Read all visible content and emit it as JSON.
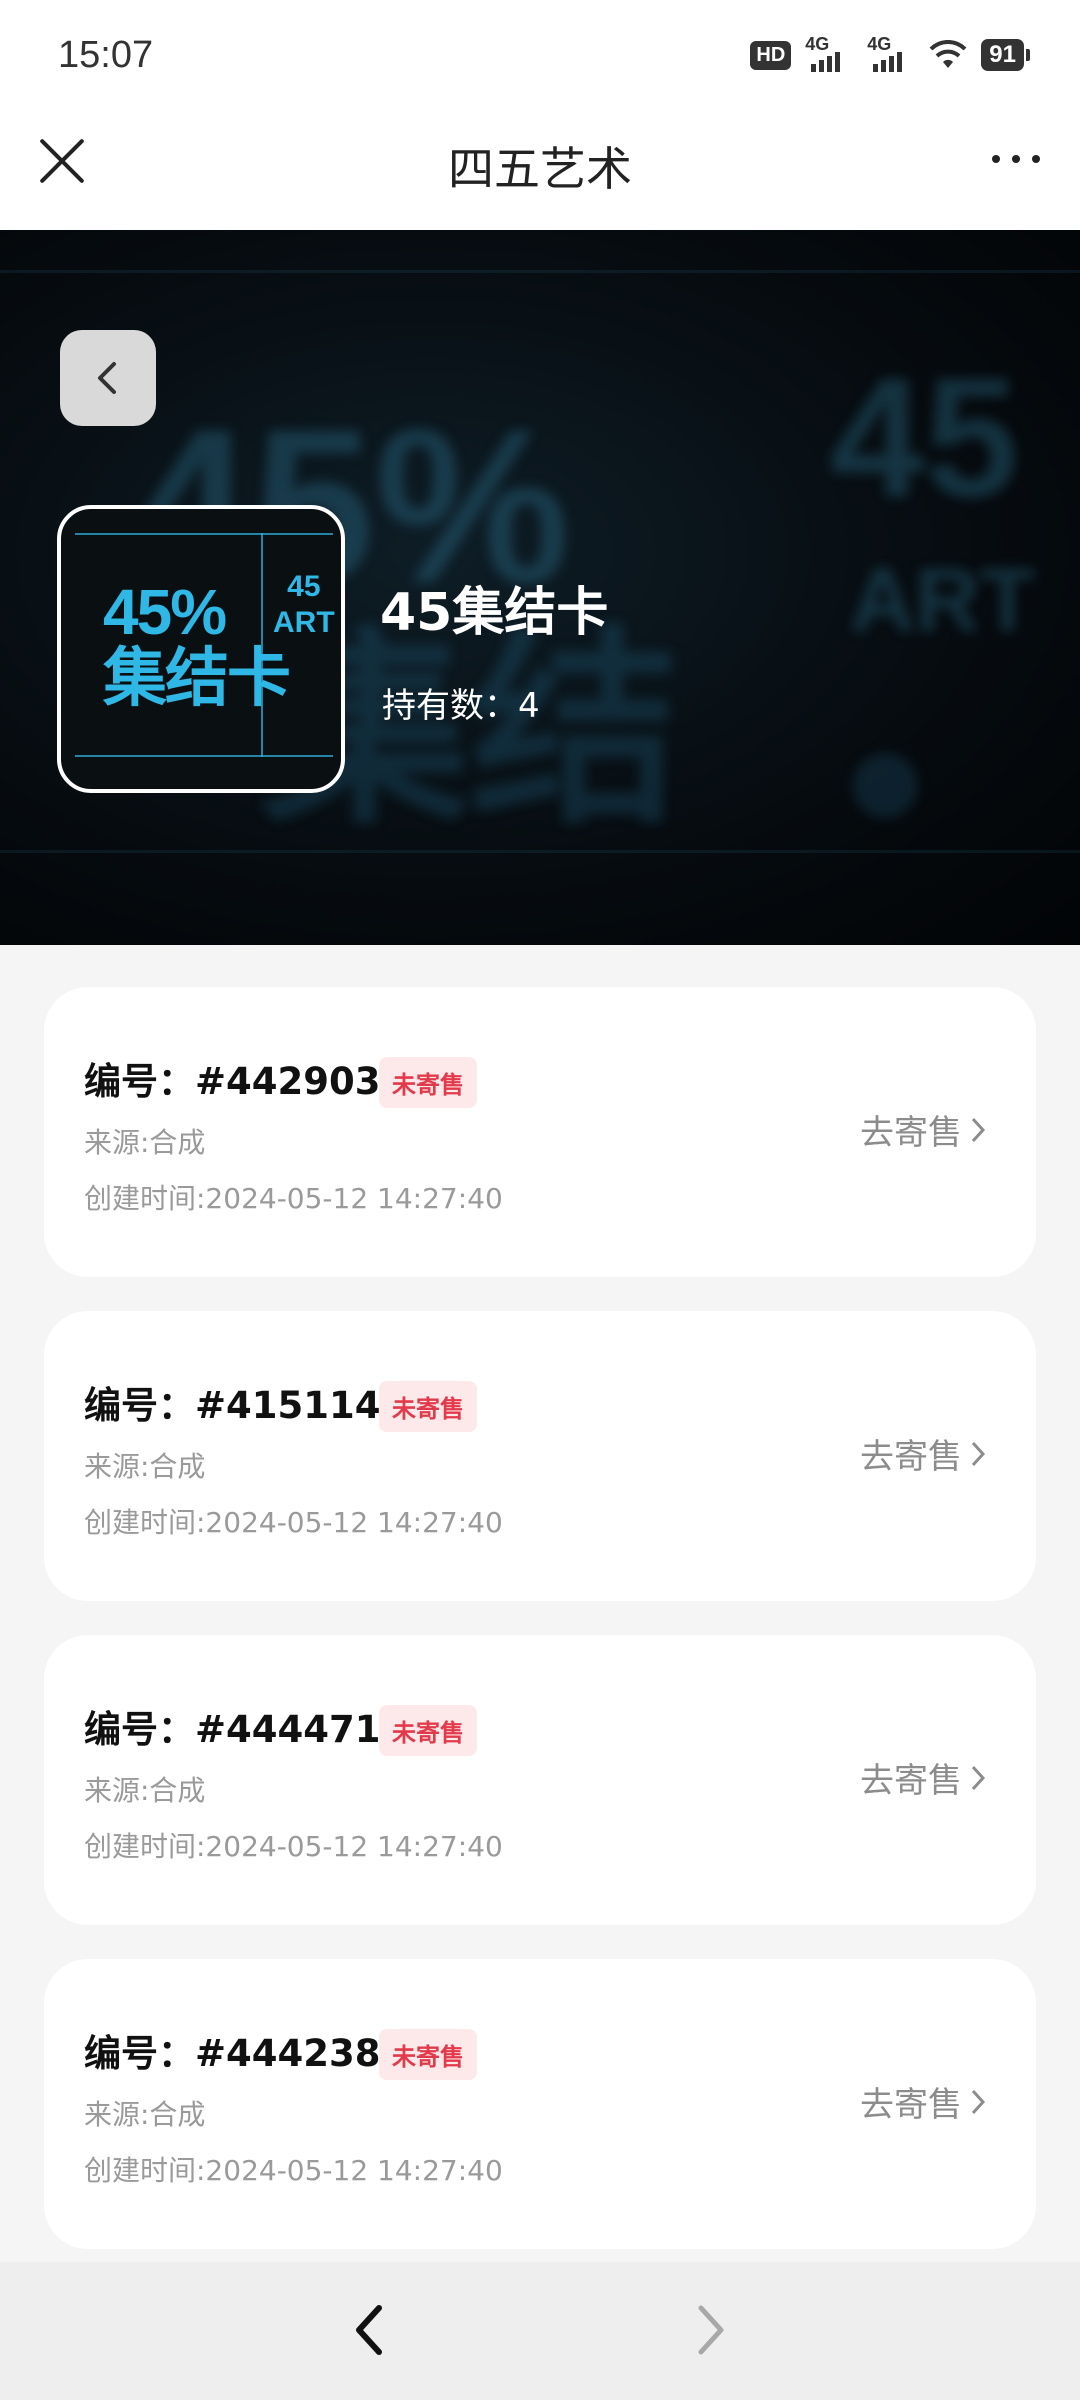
{
  "status_bar": {
    "time": "15:07",
    "hd": "HD",
    "network1": "4G",
    "network2": "4G",
    "battery": "91"
  },
  "header": {
    "title": "四五艺术"
  },
  "collection": {
    "name": "45集结卡",
    "holding_label": "持有数：",
    "holding_count": "4",
    "cover_text_main": "45%\n集结卡",
    "cover_text_side": "45\nART"
  },
  "items": [
    {
      "serial": "编号：#4429033",
      "status": "未寄售",
      "source": "来源:合成",
      "created": "创建时间:2024-05-12 14:27:40",
      "action": "去寄售"
    },
    {
      "serial": "编号：#4151143",
      "status": "未寄售",
      "source": "来源:合成",
      "created": "创建时间:2024-05-12 14:27:40",
      "action": "去寄售"
    },
    {
      "serial": "编号：#4444718",
      "status": "未寄售",
      "source": "来源:合成",
      "created": "创建时间:2024-05-12 14:27:40",
      "action": "去寄售"
    },
    {
      "serial": "编号：#4442388",
      "status": "未寄售",
      "source": "来源:合成",
      "created": "创建时间:2024-05-12 14:27:40",
      "action": "去寄售"
    }
  ],
  "colors": {
    "accent_badge_text": "#e23a4a",
    "accent_badge_bg": "#fde8ea",
    "cover_cyan": "#2fb7e6"
  }
}
